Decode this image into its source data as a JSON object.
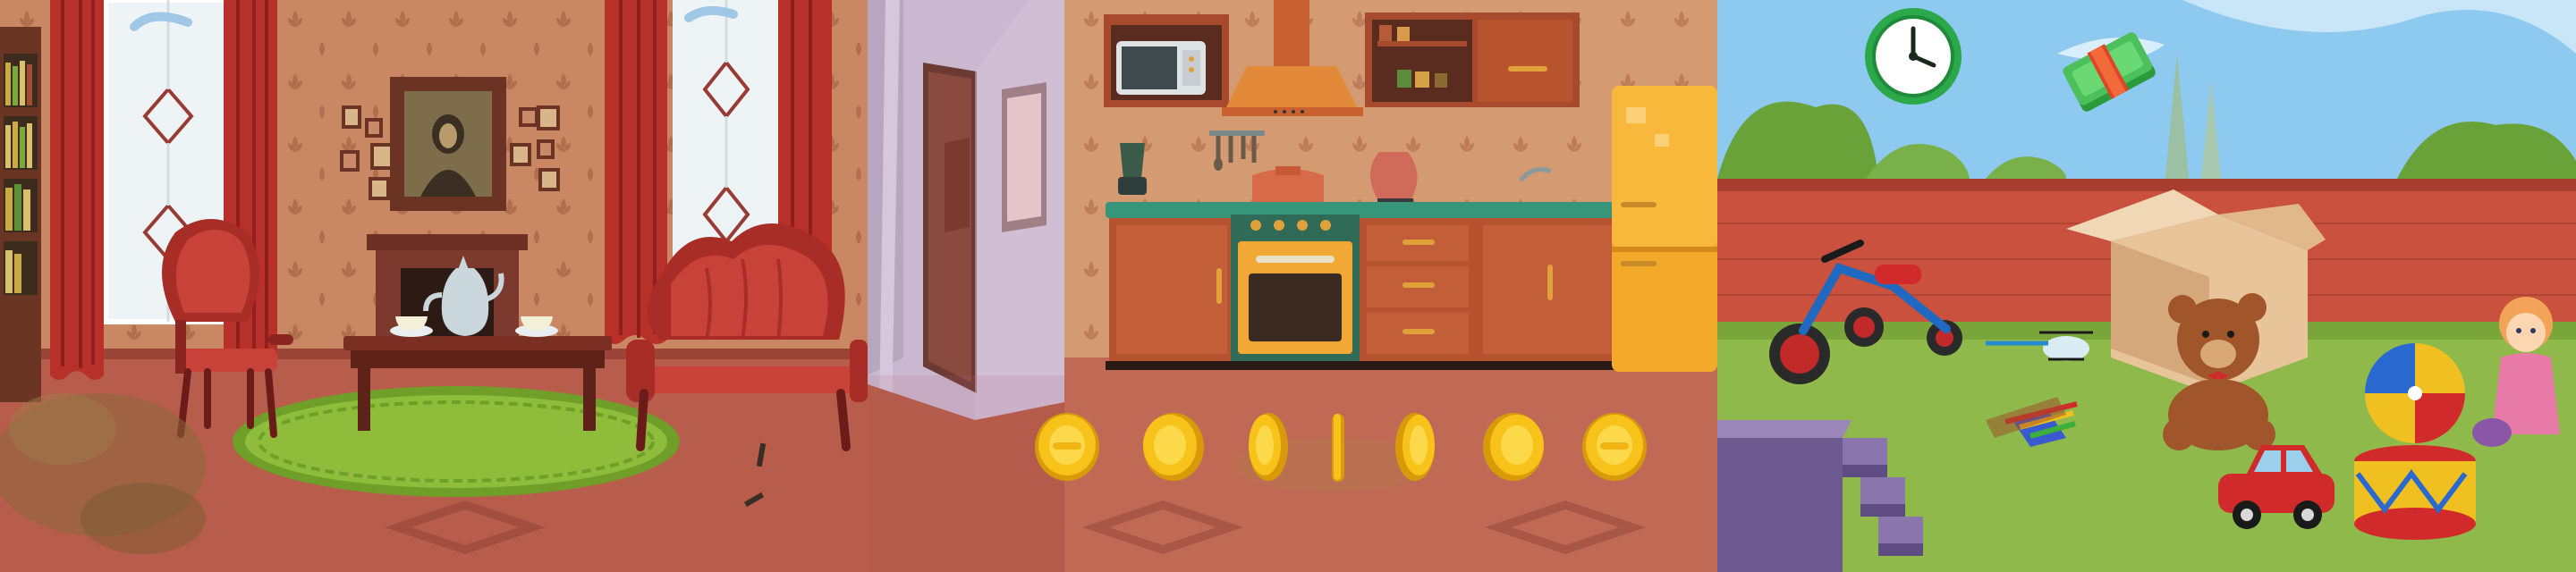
{
  "game": {
    "title": "",
    "scenes": [
      {
        "id": "living-room",
        "label": ""
      },
      {
        "id": "kitchen",
        "label": ""
      },
      {
        "id": "backyard",
        "label": ""
      }
    ]
  },
  "hud": {
    "timer_icon": "clock-icon",
    "money_icon": "cash-bundle-icon"
  },
  "collectibles": {
    "coin_count": 7,
    "coin_icon": "gold-coin-icon"
  },
  "colors": {
    "wall_pattern": "#c9835f",
    "floor_living": "#b55a4a",
    "curtain_red": "#c0302b",
    "rug_green": "#7cae2e",
    "coin_gold": "#f7c21a",
    "fridge_yellow": "#f3a92a",
    "brick_wall": "#c9513e",
    "lawn_green": "#8fb94b",
    "sky_blue": "#8ec9ef",
    "clock_green": "#2eb84a"
  }
}
